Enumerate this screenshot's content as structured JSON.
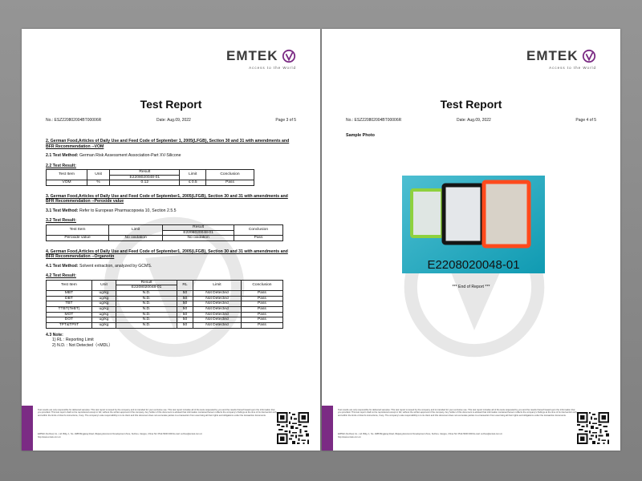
{
  "brand": {
    "name": "EMTEK",
    "tagline": "Access to the World",
    "accent": "#7b2b84"
  },
  "left_page": {
    "title": "Test Report",
    "report_no": "No.:  ESZ220802004BT00006R",
    "date": "Date: Aug.09, 2022",
    "page": "Page 3 of 5",
    "sec1_head": "2. German Food,Articles of Daily Use and Feed Code of September 1, 2005(LFGB), Section 30 and 31 with amendments and BFR Recommendation --VOM",
    "sec1_method_label": "2.1 Test Method:",
    "sec1_method": " German Risk Assessment Association-Part XV-Silicone",
    "sec1_result_head": "2.2 Test Result:",
    "t1": {
      "h_item": "Test Item",
      "h_unit": "Unit",
      "h_result": "Result",
      "h_sample": "E2208020048-01",
      "h_limit": "Limit",
      "h_concl": "Conclusion",
      "r_item": "VOM",
      "r_unit": "%",
      "r_result": "0.12",
      "r_limit": "≤ 0.5",
      "r_concl": "Pass"
    },
    "sec2_head": "3. German Food,Articles of Daily Use and Feed Code of September1, 2005(LFGB), Section 30 and 31 with amendments and BFR Recommendation --Peroxide value",
    "sec2_method_label": "3.1 Test Method:",
    "sec2_method": " Refer to European Pharmacopoeia 10, Section 2.5.5",
    "sec2_result_head": "3.2 Test Result:",
    "t2": {
      "h_item": "Test Item",
      "h_limit": "Limit",
      "h_result": "Result",
      "h_sample": "E2208020048-01",
      "h_concl": "Conclusion",
      "r_item": "Peroxide value",
      "r_limit": "No oxidation",
      "r_result": "No oxidation",
      "r_concl": "Pass"
    },
    "sec3_head": "4. German Food,Articles of Daily Use and Feed Code of September1, 2005(LFGB), Section 30 and 31 with amendments and BFR Recommendation --Organotin",
    "sec3_method_label": "4.1 Test Method:",
    "sec3_method": " Solvent extraction, analyzed by GCMS.",
    "sec3_result_head": "4.2 Test Result:",
    "t3": {
      "h_item": "Test Item",
      "h_unit": "Unit",
      "h_result": "Result",
      "h_sample": "E2208020048-01",
      "h_rl": "RL",
      "h_limit": "Limit",
      "h_concl": "Conclusion",
      "rows": [
        {
          "item": "MBT",
          "unit": "ug/kg",
          "result": "N.D.",
          "rl": "50",
          "limit": "Not Detected",
          "concl": "Pass"
        },
        {
          "item": "DBT",
          "unit": "ug/kg",
          "result": "N.D.",
          "rl": "50",
          "limit": "Not Detected",
          "concl": "Pass"
        },
        {
          "item": "TBT",
          "unit": "ug/kg",
          "result": "N.D.",
          "rl": "50",
          "limit": "Not Detected",
          "concl": "Pass"
        },
        {
          "item": "TTBT(TeBT)",
          "unit": "ug/kg",
          "result": "N.D.",
          "rl": "50",
          "limit": "Not Detected",
          "concl": "Pass"
        },
        {
          "item": "MOT",
          "unit": "ug/kg",
          "result": "N.D.",
          "rl": "50",
          "limit": "Not Detected",
          "concl": "Pass"
        },
        {
          "item": "DOT",
          "unit": "ug/kg",
          "result": "N.D.",
          "rl": "50",
          "limit": "Not Detected",
          "concl": "Pass"
        },
        {
          "item": "TPT&TPhT",
          "unit": "ug/kg",
          "result": "N.D.",
          "rl": "50",
          "limit": "Not Detected",
          "concl": "Pass"
        }
      ]
    },
    "note_head": "4.3 Note:",
    "note_1": "1) RL : Reporting Limit",
    "note_2": "2) N.D. : Not Detected（<MDL）"
  },
  "right_page": {
    "title": "Test Report",
    "report_no": "No.:  ESZ220802004BT00006R",
    "date": "Date: Aug.09, 2022",
    "page": "Page 4 of 5",
    "sample_label": "Sample Photo",
    "photo_caption": "E2208020048-01",
    "end_text": "*** End of Report ***"
  },
  "footer": {
    "disclaimer": "Test results are only responsible for delivered samples. This test report is issued by the company and is intended for your exclusive use. This test report includes all of the tests requested by you and the results thereof based upon the information that you provided. This test report shall not be reproduced except in full, without the written approval of the company. Any holder of this document is advised that information contained hereon reflects the company's findings at the time of its intervention only and within the limits of client's instructions, if any. The company's sole responsibility is to its client and this document does not exonerate parties to a transaction from exercising all their rights and obligations under the transaction documents.",
    "address": "EMTEK (Suzhou) Co., Ltd.  Bldg. 1, No. 1988 Bingjiang Road, Wujiang Economic Development Zone, Suzhou, Jiangsu, China    Tel: 0512-5000 0000  E-mail: suzhou@emtek.com.cn",
    "website": "http://www.emtek.com.cn"
  }
}
